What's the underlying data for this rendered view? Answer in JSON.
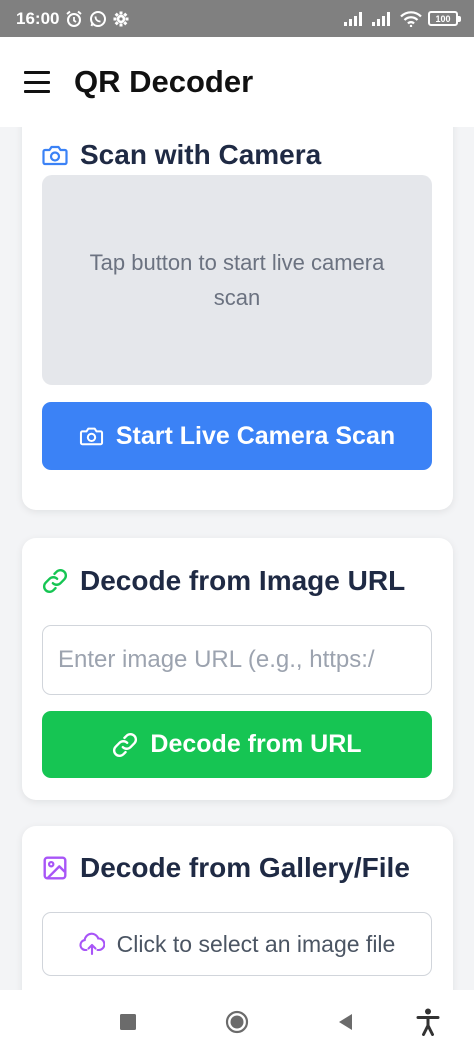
{
  "status_bar": {
    "time": "16:00",
    "battery": "100"
  },
  "app_bar": {
    "title": "QR Decoder"
  },
  "camera_card": {
    "title": "Scan with Camera",
    "placeholder_text": "Tap button to start live camera scan",
    "button_label": "Start Live Camera Scan"
  },
  "url_card": {
    "title": "Decode from Image URL",
    "input_placeholder": "Enter image URL (e.g., https:/",
    "button_label": "Decode from URL"
  },
  "gallery_card": {
    "title": "Decode from Gallery/File",
    "button_label": "Click to select an image file"
  },
  "colors": {
    "primary_blue": "#3b82f6",
    "success_green": "#16c553",
    "gallery_purple": "#a855f7",
    "title_text": "#1f2a44"
  },
  "icons": {
    "camera_card": "camera-icon",
    "url_card": "link-icon",
    "gallery_card": "image-icon",
    "file_button": "upload-cloud-icon"
  }
}
